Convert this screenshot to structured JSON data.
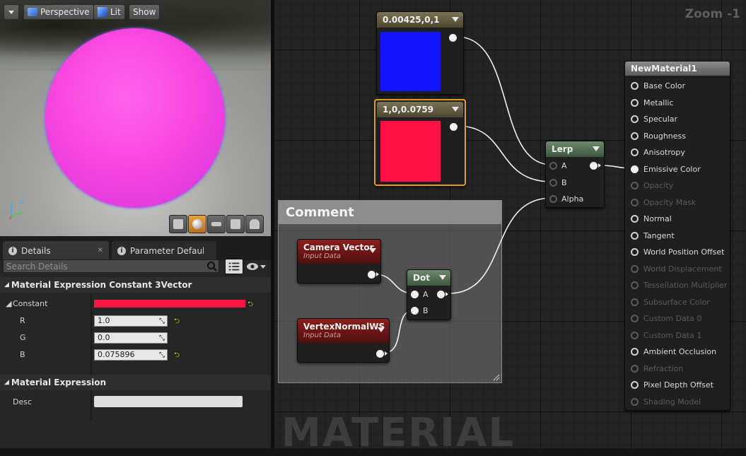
{
  "viewport": {
    "perspective_label": "Perspective",
    "lit_label": "Lit",
    "show_label": "Show"
  },
  "details": {
    "tabs": [
      {
        "label": "Details"
      },
      {
        "label": "Parameter Defaults"
      }
    ],
    "search_placeholder": "Search Details",
    "section1_title": "Material Expression Constant 3Vector",
    "constant_label": "Constant",
    "constant_color": "#ff1744",
    "r_label": "R",
    "r_value": "1.0",
    "g_label": "G",
    "g_value": "0.0",
    "b_label": "B",
    "b_value": "0.075896",
    "section2_title": "Material Expression",
    "desc_label": "Desc",
    "desc_value": ""
  },
  "graph": {
    "zoom_label": "Zoom -1",
    "watermark": "MATERIAL",
    "blue_node": {
      "title": "0.00425,0,1",
      "color": "#1414ff"
    },
    "red_node": {
      "title": "1,0,0.0759",
      "color": "#ff1047"
    },
    "lerp": {
      "title": "Lerp",
      "pins": [
        "A",
        "B",
        "Alpha"
      ]
    },
    "comment_title": "Comment",
    "camera_vector": {
      "title": "Camera Vector",
      "subtitle": "Input Data"
    },
    "vertex_normal": {
      "title": "VertexNormalWS",
      "subtitle": "Input Data"
    },
    "dot": {
      "title": "Dot",
      "pins": [
        "A",
        "B"
      ]
    },
    "material": {
      "title": "NewMaterial1",
      "pins": [
        {
          "label": "Base Color",
          "enabled": true
        },
        {
          "label": "Metallic",
          "enabled": true
        },
        {
          "label": "Specular",
          "enabled": true
        },
        {
          "label": "Roughness",
          "enabled": true
        },
        {
          "label": "Anisotropy",
          "enabled": true
        },
        {
          "label": "Emissive Color",
          "enabled": true
        },
        {
          "label": "Opacity",
          "enabled": false
        },
        {
          "label": "Opacity Mask",
          "enabled": false
        },
        {
          "label": "Normal",
          "enabled": true
        },
        {
          "label": "Tangent",
          "enabled": true
        },
        {
          "label": "World Position Offset",
          "enabled": true
        },
        {
          "label": "World Displacement",
          "enabled": false
        },
        {
          "label": "Tessellation Multiplier",
          "enabled": false
        },
        {
          "label": "Subsurface Color",
          "enabled": false
        },
        {
          "label": "Custom Data 0",
          "enabled": false
        },
        {
          "label": "Custom Data 1",
          "enabled": false
        },
        {
          "label": "Ambient Occlusion",
          "enabled": true
        },
        {
          "label": "Refraction",
          "enabled": false
        },
        {
          "label": "Pixel Depth Offset",
          "enabled": true
        },
        {
          "label": "Shading Model",
          "enabled": false
        }
      ]
    }
  }
}
